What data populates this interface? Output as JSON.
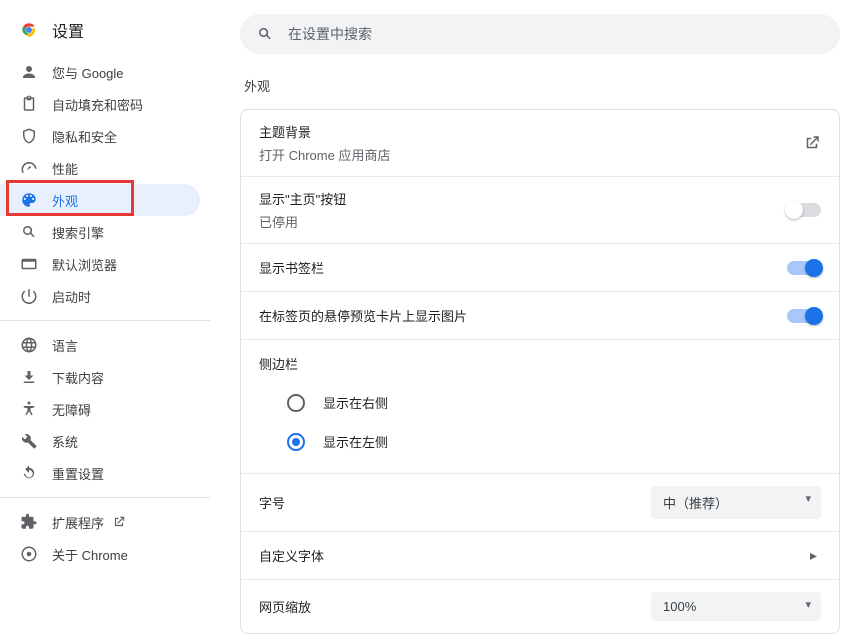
{
  "header": {
    "title": "设置"
  },
  "search": {
    "placeholder": "在设置中搜索"
  },
  "nav": {
    "items": [
      {
        "label": "您与 Google"
      },
      {
        "label": "自动填充和密码"
      },
      {
        "label": "隐私和安全"
      },
      {
        "label": "性能"
      },
      {
        "label": "外观"
      },
      {
        "label": "搜索引擎"
      },
      {
        "label": "默认浏览器"
      },
      {
        "label": "启动时"
      }
    ],
    "items2": [
      {
        "label": "语言"
      },
      {
        "label": "下载内容"
      },
      {
        "label": "无障碍"
      },
      {
        "label": "系统"
      },
      {
        "label": "重置设置"
      }
    ],
    "items3": [
      {
        "label": "扩展程序"
      },
      {
        "label": "关于 Chrome"
      }
    ]
  },
  "section": {
    "title": "外观"
  },
  "appearance": {
    "theme_title": "主题背景",
    "theme_sub": "打开 Chrome 应用商店",
    "home_button_title": "显示\"主页\"按钮",
    "home_button_sub": "已停用",
    "bookmarks_bar": "显示书签栏",
    "tab_hover_preview": "在标签页的悬停预览卡片上显示图片",
    "sidebar_title": "侧边栏",
    "sidebar_right": "显示在右侧",
    "sidebar_left": "显示在左侧",
    "font_size_label": "字号",
    "font_size_value": "中（推荐）",
    "custom_fonts": "自定义字体",
    "page_zoom_label": "网页缩放",
    "page_zoom_value": "100%"
  },
  "toggles": {
    "home_button": false,
    "bookmarks_bar": true,
    "tab_hover_preview": true
  }
}
